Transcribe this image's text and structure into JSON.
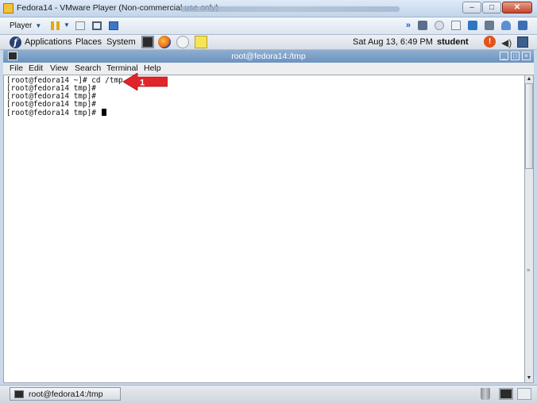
{
  "vmware": {
    "title": "Fedora14 - VMware Player (Non-commercial use only)",
    "menu_player": "Player",
    "controls": {
      "minimize": "–",
      "maximize": "□",
      "close": "✕"
    }
  },
  "gnome_panel": {
    "menus": [
      "Applications",
      "Places",
      "System"
    ],
    "clock": "Sat Aug 13,  6:49 PM",
    "user": "student"
  },
  "terminal": {
    "title": "root@fedora14:/tmp",
    "menu": [
      "File",
      "Edit",
      "View",
      "Search",
      "Terminal",
      "Help"
    ],
    "lines": [
      "[root@fedora14 ~]# cd /tmp",
      "[root@fedora14 tmp]#",
      "[root@fedora14 tmp]#",
      "[root@fedora14 tmp]#",
      "[root@fedora14 tmp]# "
    ]
  },
  "annotation": {
    "label": "1",
    "color": "#e0252b"
  },
  "taskbar": {
    "window_button": "root@fedora14:/tmp"
  },
  "icons": {
    "fedora": "fedora-logo-icon",
    "terminal": "terminal-icon",
    "browser": "firefox-icon",
    "mail": "mail-icon",
    "notes": "notes-icon",
    "trash": "trash-icon",
    "volume": "volume-icon"
  }
}
